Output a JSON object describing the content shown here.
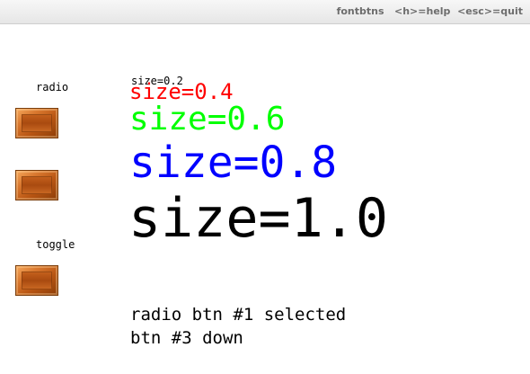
{
  "window": {
    "title": "fontbtns   <h>=help  <esc>=quit"
  },
  "labels": {
    "radio": "radio",
    "toggle": "toggle"
  },
  "size_samples": [
    {
      "text": "size=0.2",
      "color": "#000000"
    },
    {
      "text": "size=0.4",
      "color": "#ff0000"
    },
    {
      "text": "size=0.6",
      "color": "#00ff00"
    },
    {
      "text": "size=0.8",
      "color": "#0000ff"
    },
    {
      "text": "size=1.0",
      "color": "#000000"
    }
  ],
  "buttons": [
    {
      "name": "radio-button-1",
      "icon": "wood-button"
    },
    {
      "name": "radio-button-2",
      "icon": "wood-button"
    },
    {
      "name": "toggle-button",
      "icon": "wood-button"
    }
  ],
  "status": {
    "line1": "radio btn #1 selected",
    "line2": "btn #3 down"
  }
}
